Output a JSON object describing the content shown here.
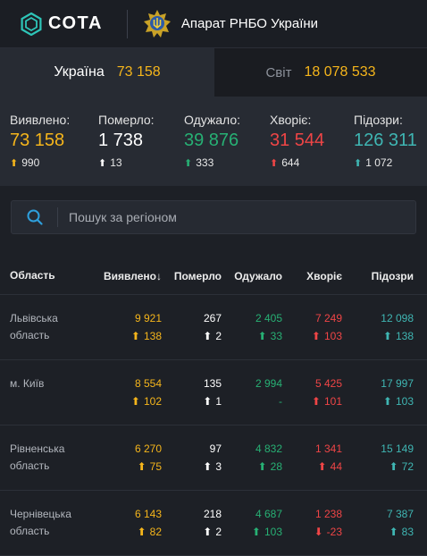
{
  "brand": {
    "name": "СОТА",
    "org": "Апарат РНБО України"
  },
  "tabs": [
    {
      "label": "Україна",
      "value": "73 158"
    },
    {
      "label": "Світ",
      "value": "18 078 533"
    }
  ],
  "stats": [
    {
      "label": "Виявлено:",
      "value": "73 158",
      "delta": "990",
      "arrow": "up",
      "color": "#f5b51b"
    },
    {
      "label": "Померло:",
      "value": "1 738",
      "delta": "13",
      "arrow": "up",
      "color": "#ffffff"
    },
    {
      "label": "Одужало:",
      "value": "39 876",
      "delta": "333",
      "arrow": "up",
      "color": "#27b074"
    },
    {
      "label": "Хворіє:",
      "value": "31 544",
      "delta": "644",
      "arrow": "up",
      "color": "#ef4546"
    },
    {
      "label": "Підозри:",
      "value": "126 311",
      "delta": "1 072",
      "arrow": "up",
      "color": "#3fb6b3"
    }
  ],
  "search": {
    "placeholder": "Пошук за регіоном"
  },
  "table": {
    "headers": {
      "region": "Область",
      "confirmed": "Виявлено",
      "deaths": "Померло",
      "recovered": "Одужало",
      "sick": "Хворіє",
      "suspected": "Підозри"
    },
    "sort_arrow": "↓",
    "rows": [
      {
        "region_line1": "Львівська",
        "region_line2": "область",
        "confirmed": "9 921",
        "confirmed_delta": "138",
        "deaths": "267",
        "deaths_delta": "2",
        "recovered": "2 405",
        "recovered_delta": "33",
        "sick": "7 249",
        "sick_delta": "103",
        "suspected": "12 098",
        "suspected_delta": "138"
      },
      {
        "region_line1": "м. Київ",
        "region_line2": "",
        "confirmed": "8 554",
        "confirmed_delta": "102",
        "deaths": "135",
        "deaths_delta": "1",
        "recovered": "2 994",
        "recovered_delta": "-",
        "sick": "5 425",
        "sick_delta": "101",
        "suspected": "17 997",
        "suspected_delta": "103"
      },
      {
        "region_line1": "Рівненська",
        "region_line2": "область",
        "confirmed": "6 270",
        "confirmed_delta": "75",
        "deaths": "97",
        "deaths_delta": "3",
        "recovered": "4 832",
        "recovered_delta": "28",
        "sick": "1 341",
        "sick_delta": "44",
        "suspected": "15 149",
        "suspected_delta": "72"
      },
      {
        "region_line1": "Чернівецька",
        "region_line2": "область",
        "confirmed": "6 143",
        "confirmed_delta": "82",
        "deaths": "218",
        "deaths_delta": "2",
        "recovered": "4 687",
        "recovered_delta": "103",
        "sick": "1 238",
        "sick_delta": "-23",
        "suspected": "7 387",
        "suspected_delta": "83"
      }
    ]
  },
  "colors": {
    "confirmed": "#f5b51b",
    "deaths": "#ffffff",
    "recovered": "#27b074",
    "sick": "#ef4546",
    "suspected": "#3fb6b3",
    "background": "#1d2026",
    "panel": "#272b33"
  }
}
